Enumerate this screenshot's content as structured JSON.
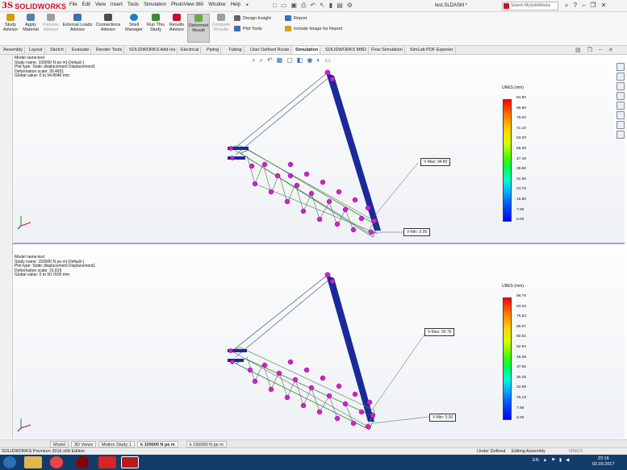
{
  "app": {
    "brand_ds": "3S",
    "brand_name": "SOLIDWORKS",
    "document_title": "test.SLDASM *"
  },
  "menu": [
    "File",
    "Edit",
    "View",
    "Insert",
    "Tools",
    "Simulation",
    "PhotoView 360",
    "Window",
    "Help"
  ],
  "search": {
    "placeholder": "Search MySolidWorks"
  },
  "ribbon": {
    "buttons": [
      {
        "label": "Study Advisor",
        "color": "#d79b1a"
      },
      {
        "label": "Apply Material",
        "color": "#5a7fb0"
      },
      {
        "label": "Fixtures Advisor",
        "color": "#9aa0a6"
      },
      {
        "label": "External Loads Advisor",
        "color": "#3c6fb6"
      },
      {
        "label": "Connections Advisor",
        "color": "#4d4d4d"
      },
      {
        "label": "Shell Manager",
        "color": "#1c7fc4"
      },
      {
        "label": "Run This Study",
        "color": "#3c8a3c"
      },
      {
        "label": "Results Advisor",
        "color": "#c8102e"
      },
      {
        "label": "Deformed Result",
        "color": "#5fae3a"
      },
      {
        "label": "Compare Results",
        "color": "#9aa0a6"
      }
    ],
    "design_insight": "Design Insight",
    "plot_tools": "Plot Tools",
    "report": "Report",
    "include_image": "Include Image for Report"
  },
  "tabs": [
    "Assembly",
    "Layout",
    "Sketch",
    "Evaluate",
    "Render Tools",
    "SOLIDWORKS Add-Ins",
    "Electrical",
    "Piping",
    "Tubing",
    "User Defined Route",
    "Simulation",
    "SOLIDWORKS MBD",
    "Flow Simulation",
    "SimLab PDF Exporter"
  ],
  "active_tab": "Simulation",
  "viewport1": {
    "info": [
      "Model name:test",
      "Study name: 100000 N pe m(-Default-)",
      "Plot type: Static displacement Displacement1",
      "Deformation scale: 30.4651",
      "Global value: 0 to 94.8040 mm"
    ],
    "legend_title": "URES (mm)",
    "legend_values": [
      "94.80",
      "86.80",
      "79.00",
      "71.10",
      "63.20",
      "55.30",
      "47.40",
      "39.50",
      "31.60",
      "23.70",
      "15.80",
      "7.90",
      "0.00"
    ],
    "probe_max_label": "V-Max:",
    "probe_max": "94.80",
    "probe_min_label": "V-Min:",
    "probe_min": "0.00"
  },
  "viewport2": {
    "info": [
      "Model name:test",
      "Study name: 150000 N pe m(-Default-)",
      "Plot type: Static displacement Displacement1",
      "Deformation scale: 31.816",
      "Global value: 0 to 90.7605 mm"
    ],
    "legend_title": "URES (mm)",
    "legend_values": [
      "98.76",
      "83.20",
      "75.63",
      "68.07",
      "60.51",
      "52.94",
      "45.38",
      "37.82",
      "30.25",
      "22.69",
      "15.13",
      "7.56",
      "0.00"
    ],
    "probe_max_label": "V-Max:",
    "probe_max": "90.76",
    "probe_min_label": "V-Min:",
    "probe_min": "0.00"
  },
  "model_tabs": [
    "Model",
    "3D Views",
    "Motion Study 1",
    "k 100000 N pe m",
    "k 150000 N pe m"
  ],
  "status": {
    "edition": "SOLIDWORKS Premium 2016 x64 Edition",
    "under_defined": "Under Defined",
    "editing": "Editing Assembly",
    "units": "MMGS"
  },
  "taskbar": {
    "lang": "EN",
    "time": "23:16",
    "date": "02.09.2017"
  }
}
